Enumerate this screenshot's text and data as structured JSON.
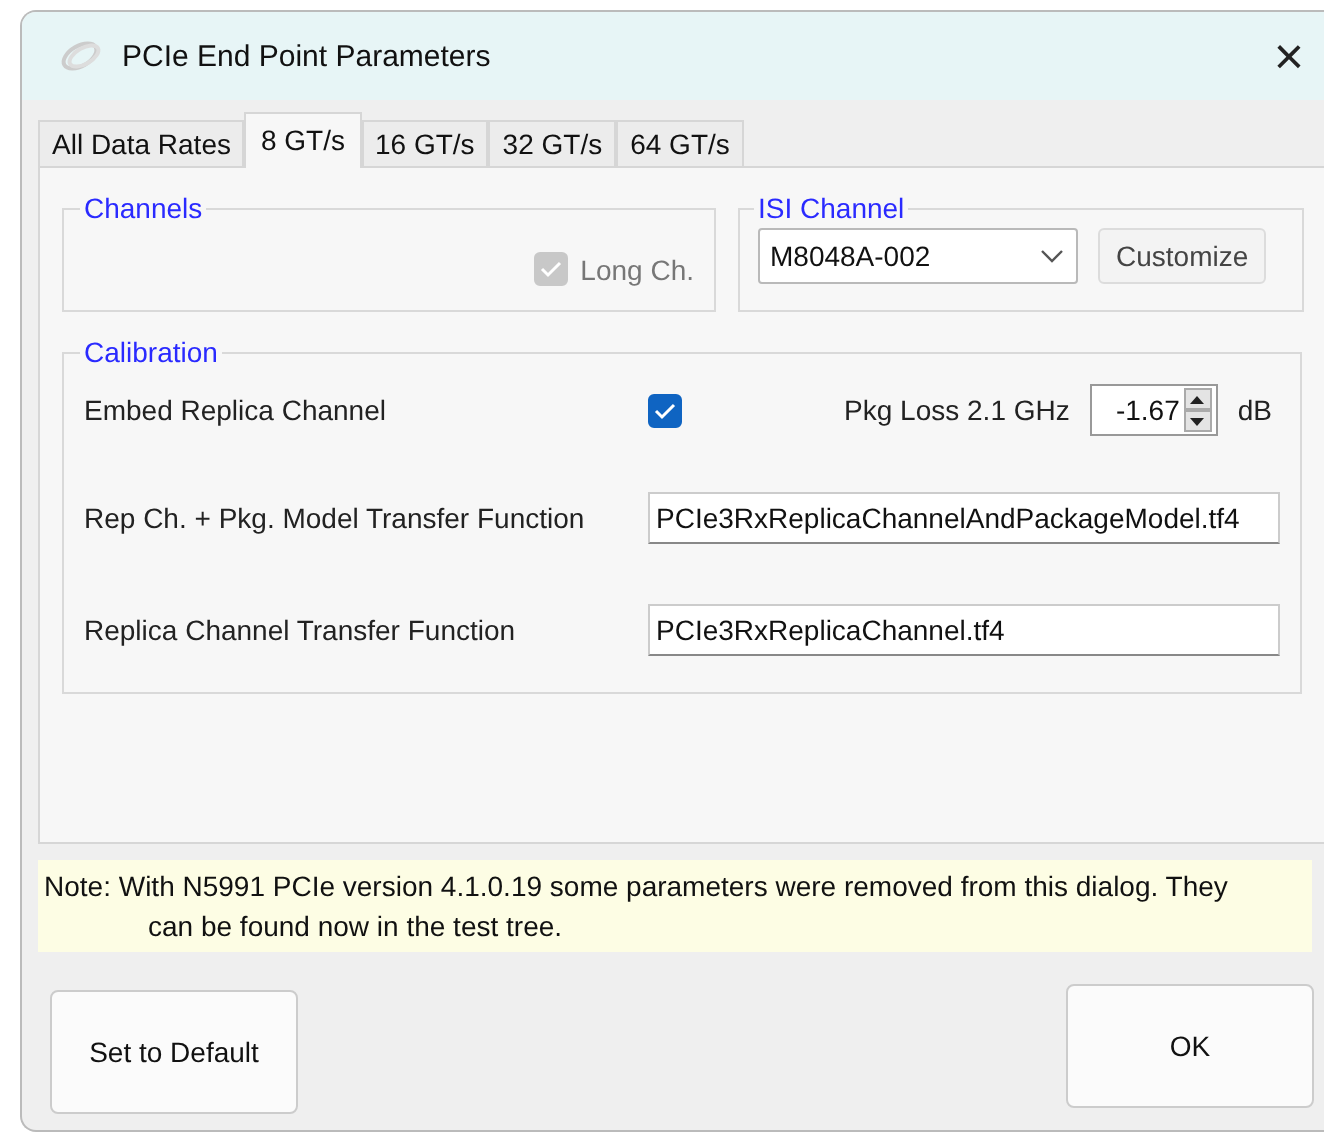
{
  "window": {
    "title": "PCIe End Point Parameters",
    "close": "×"
  },
  "tabs": [
    {
      "label": "All Data Rates",
      "selected": false
    },
    {
      "label": "8 GT/s",
      "selected": true
    },
    {
      "label": "16 GT/s",
      "selected": false
    },
    {
      "label": "32 GT/s",
      "selected": false
    },
    {
      "label": "64 GT/s",
      "selected": false
    }
  ],
  "channels": {
    "title": "Channels",
    "long_ch": {
      "label": "Long Ch.",
      "checked": true,
      "disabled": true
    }
  },
  "isi_channel": {
    "title": "ISI Channel",
    "value": "M8048A-002",
    "button": "Customize"
  },
  "calibration": {
    "title": "Calibration",
    "embed": {
      "label": "Embed Replica Channel",
      "checked": true
    },
    "pkg_loss": {
      "label": "Pkg Loss 2.1 GHz",
      "value": "-1.67",
      "unit": "dB"
    },
    "fields": [
      {
        "label": "Rep Ch. + Pkg. Model Transfer Function",
        "value": "PCIe3RxReplicaChannelAndPackageModel.tf4"
      },
      {
        "label": "Replica Channel Transfer Function",
        "value": "PCIe3RxReplicaChannel.tf4"
      }
    ]
  },
  "note": "Note: With N5991 PCIe version 4.1.0.19 some parameters were removed from this dialog. They can be found now in the test tree.",
  "buttons": [
    {
      "label": "Set to Default",
      "kind": "secondary"
    },
    {
      "label": "OK",
      "kind": "primary"
    }
  ]
}
